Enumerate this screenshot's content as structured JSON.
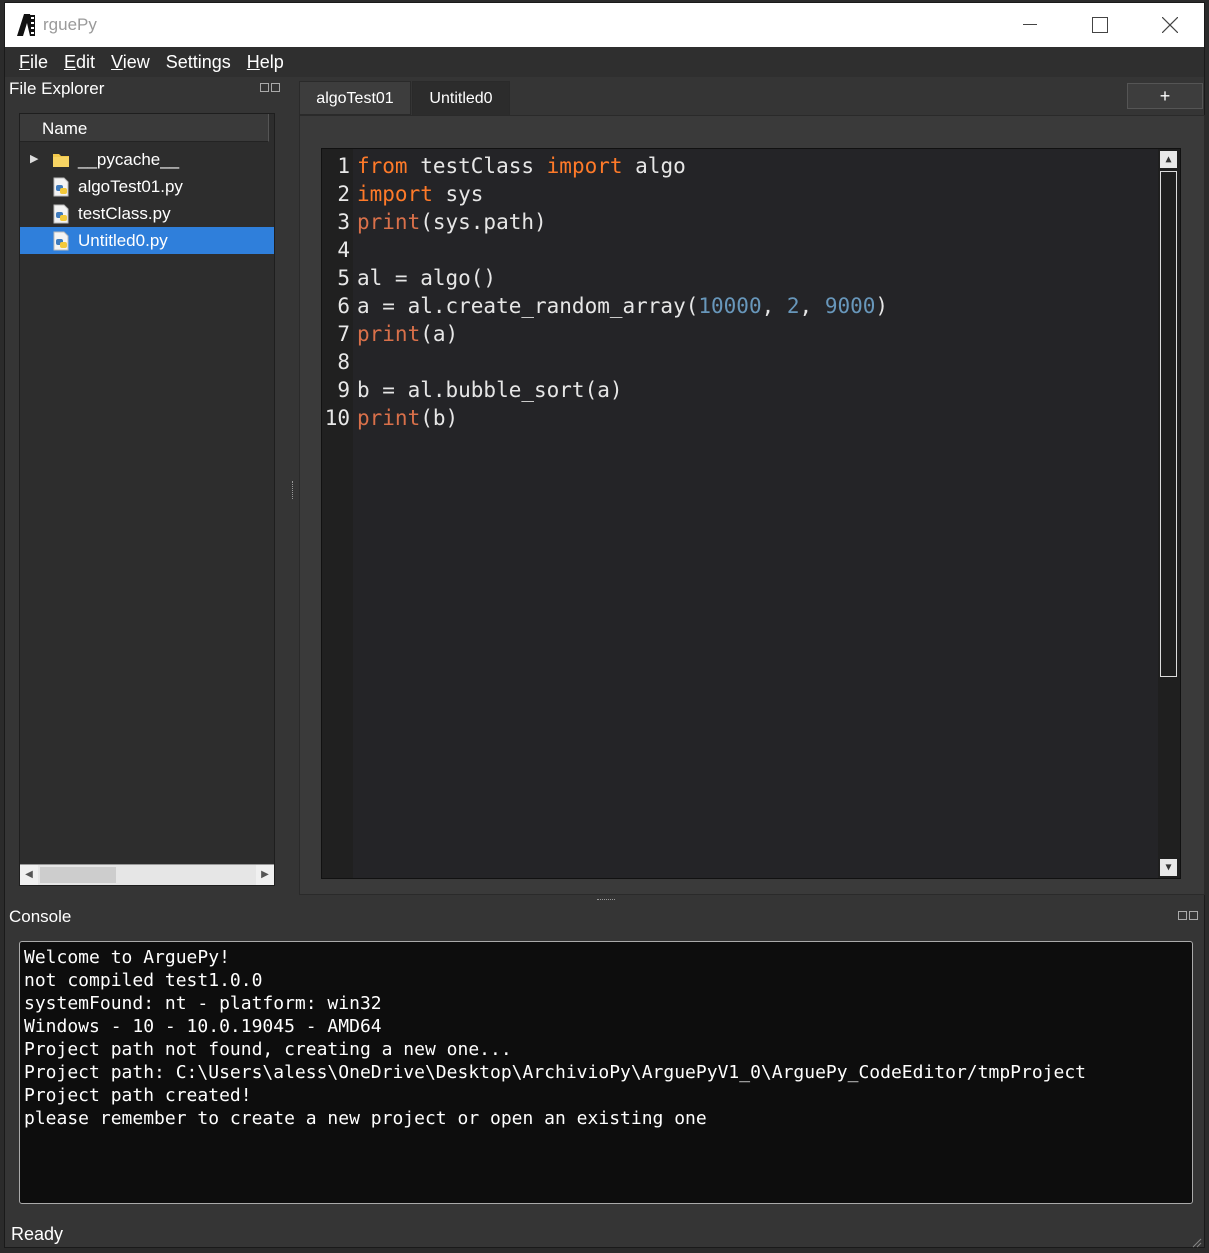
{
  "window": {
    "title": "rguePy",
    "minimize_glyph": "—",
    "maximize_glyph": "☐",
    "close_glyph": "✕"
  },
  "menu": [
    {
      "mnemonic": "F",
      "rest": "ile"
    },
    {
      "mnemonic": "E",
      "rest": "dit"
    },
    {
      "mnemonic": "V",
      "rest": "iew"
    },
    {
      "mnemonic": "",
      "rest": "Settings"
    },
    {
      "mnemonic": "H",
      "rest": "elp"
    }
  ],
  "file_explorer": {
    "title": "File Explorer",
    "column_header": "Name",
    "items": [
      {
        "label": "__pycache__",
        "type": "folder",
        "expandable": true,
        "selected": false
      },
      {
        "label": "algoTest01.py",
        "type": "python-file",
        "expandable": false,
        "selected": false
      },
      {
        "label": "testClass.py",
        "type": "python-file",
        "expandable": false,
        "selected": false
      },
      {
        "label": "Untitled0.py",
        "type": "python-file",
        "expandable": false,
        "selected": true
      }
    ]
  },
  "tabs": [
    {
      "label": "algoTest01",
      "active": false
    },
    {
      "label": "Untitled0",
      "active": true
    }
  ],
  "add_tab_label": "+",
  "editor": {
    "line_numbers": [
      "1",
      "2",
      "3",
      "4",
      "5",
      "6",
      "7",
      "8",
      "9",
      "10"
    ],
    "lines": [
      [
        {
          "t": "from",
          "c": "kw"
        },
        {
          "t": " testClass ",
          "c": "txt"
        },
        {
          "t": "import",
          "c": "kw"
        },
        {
          "t": " algo",
          "c": "txt"
        }
      ],
      [
        {
          "t": "import",
          "c": "kw"
        },
        {
          "t": " sys",
          "c": "txt"
        }
      ],
      [
        {
          "t": "print",
          "c": "bi"
        },
        {
          "t": "(sys.path)",
          "c": "txt"
        }
      ],
      [],
      [
        {
          "t": "al = algo()",
          "c": "txt"
        }
      ],
      [
        {
          "t": "a = al.create_random_array(",
          "c": "txt"
        },
        {
          "t": "10000",
          "c": "num"
        },
        {
          "t": ", ",
          "c": "txt"
        },
        {
          "t": "2",
          "c": "num"
        },
        {
          "t": ", ",
          "c": "txt"
        },
        {
          "t": "9000",
          "c": "num"
        },
        {
          "t": ")",
          "c": "txt"
        }
      ],
      [
        {
          "t": "print",
          "c": "bi"
        },
        {
          "t": "(a)",
          "c": "txt"
        }
      ],
      [],
      [
        {
          "t": "b = al.bubble_sort(a)",
          "c": "txt"
        }
      ],
      [
        {
          "t": "print",
          "c": "bi"
        },
        {
          "t": "(b)",
          "c": "txt"
        }
      ]
    ]
  },
  "console": {
    "title": "Console",
    "lines": [
      "Welcome to ArguePy!",
      "not compiled test1.0.0",
      "systemFound: nt - platform: win32",
      "Windows - 10 - 10.0.19045 - AMD64",
      "Project path not found, creating a new one...",
      "Project path: C:\\Users\\aless\\OneDrive\\Desktop\\ArchivioPy\\ArguePyV1_0\\ArguePy_CodeEditor/tmpProject",
      "Project path created!",
      "please remember to create a new project or open an existing one"
    ]
  },
  "status_bar": {
    "text": "Ready"
  },
  "colors": {
    "keyword": "#ff7a29",
    "builtin": "#d9704a",
    "number": "#6897bb",
    "selection": "#2f7fdb"
  }
}
